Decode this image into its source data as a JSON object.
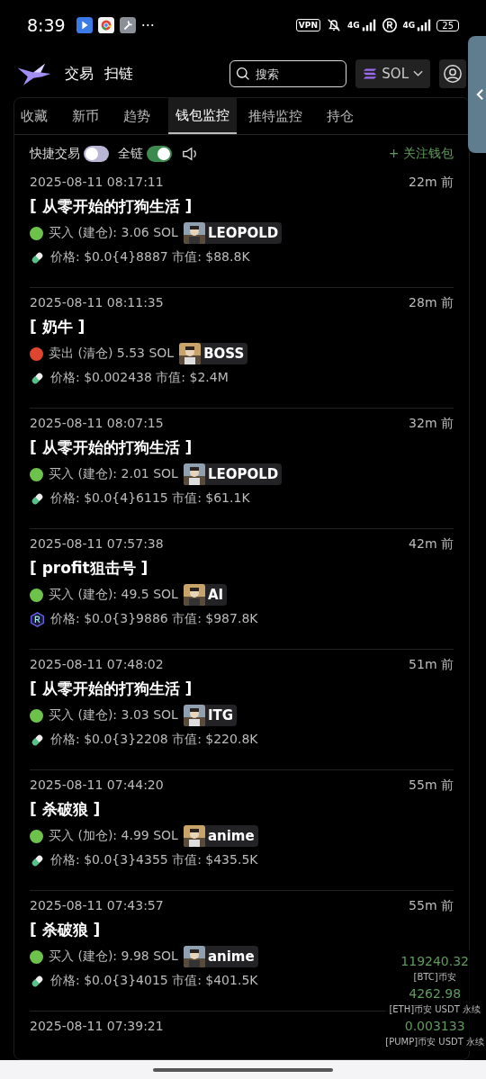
{
  "status_bar": {
    "time": "8:39",
    "more": "···",
    "vpn": "VPN",
    "network_1": "4G",
    "network_2": "4G",
    "battery": "25"
  },
  "header": {
    "nav": [
      {
        "label": "交易"
      },
      {
        "label": "扫链"
      }
    ],
    "search": {
      "placeholder": "搜索"
    },
    "chain": "SOL"
  },
  "tabs": [
    {
      "label": "收藏",
      "selected": false
    },
    {
      "label": "新币",
      "selected": false
    },
    {
      "label": "趋势",
      "selected": false
    },
    {
      "label": "钱包监控",
      "selected": true
    },
    {
      "label": "推特监控",
      "selected": false
    },
    {
      "label": "持仓",
      "selected": false
    }
  ],
  "toolbar": {
    "quick_trade": {
      "label": "快捷交易",
      "on": false
    },
    "all_chains": {
      "label": "全链",
      "on": true
    },
    "follow": "+ 关注钱包"
  },
  "feed": [
    {
      "time": "2025-08-11 08:17:11",
      "ago": "22m 前",
      "title": "[ 从零开始的打狗生活 ]",
      "trade": {
        "kind": "buy",
        "text": "买入 (建仓): 3.06 SOL"
      },
      "wallet": "LEOPOLD",
      "price": {
        "kind": "pill",
        "text": "价格: $0.0{4}8887 市值: $88.8K"
      }
    },
    {
      "time": "2025-08-11 08:11:35",
      "ago": "28m 前",
      "title": "[ 奶牛 ]",
      "trade": {
        "kind": "sell",
        "text": "卖出 (清仓) 5.53 SOL"
      },
      "wallet": "BOSS",
      "price": {
        "kind": "pill",
        "text": "价格: $0.002438 市值: $2.4M"
      }
    },
    {
      "time": "2025-08-11 08:07:15",
      "ago": "32m 前",
      "title": "[ 从零开始的打狗生活 ]",
      "trade": {
        "kind": "buy",
        "text": "买入 (建仓): 2.01 SOL"
      },
      "wallet": "LEOPOLD",
      "price": {
        "kind": "pill",
        "text": "价格: $0.0{4}6115 市值: $61.1K"
      }
    },
    {
      "time": "2025-08-11 07:57:38",
      "ago": "42m 前",
      "title": "[ profit狙击号 ]",
      "trade": {
        "kind": "buy",
        "text": "买入 (建仓): 49.5 SOL"
      },
      "wallet": "AI",
      "price": {
        "kind": "hexagon",
        "text": "价格: $0.0{3}9886 市值: $987.8K"
      }
    },
    {
      "time": "2025-08-11 07:48:02",
      "ago": "51m 前",
      "title": "[ 从零开始的打狗生活 ]",
      "trade": {
        "kind": "buy",
        "text": "买入 (建仓): 3.03 SOL"
      },
      "wallet": "ITG",
      "price": {
        "kind": "pill",
        "text": "价格: $0.0{3}2208 市值: $220.8K"
      }
    },
    {
      "time": "2025-08-11 07:44:20",
      "ago": "55m 前",
      "title": "[ 杀破狼 ]",
      "trade": {
        "kind": "buy",
        "text": "买入 (加仓): 4.99 SOL"
      },
      "wallet": "anime",
      "price": {
        "kind": "pill",
        "text": "价格: $0.0{3}4355 市值: $435.5K"
      }
    },
    {
      "time": "2025-08-11 07:43:57",
      "ago": "55m 前",
      "title": "[ 杀破狼 ]",
      "trade": {
        "kind": "buy",
        "text": "买入 (建仓): 9.98 SOL"
      },
      "wallet": "anime",
      "price": {
        "kind": "pill",
        "text": "价格: $0.0{3}4015 市值: $401.5K"
      }
    },
    {
      "time": "2025-08-11 07:39:21"
    }
  ],
  "ticker": [
    {
      "value": "119240.32",
      "label": "[BTC]币安"
    },
    {
      "value": "4262.98",
      "label": "[ETH]币安 USDT 永续"
    },
    {
      "value": "0.003133",
      "label": "[PUMP]币安 USDT 永续"
    }
  ]
}
